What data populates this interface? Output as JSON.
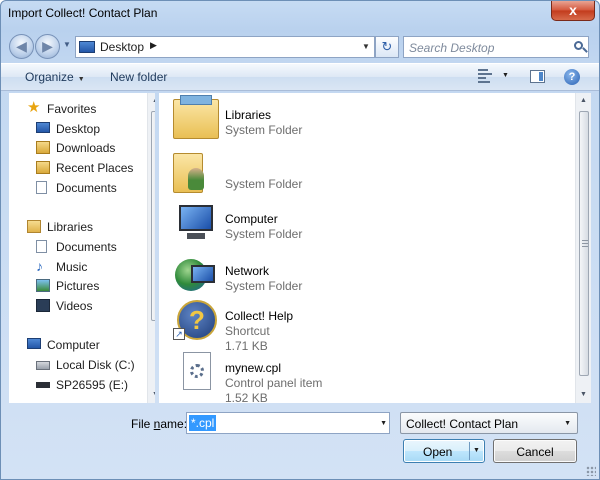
{
  "window": {
    "title": "Import Collect! Contact Plan",
    "close_glyph": "x"
  },
  "navigation": {
    "back_glyph": "◀",
    "forward_glyph": "▶",
    "address": {
      "location": "Desktop",
      "crumb_arrow": "▶"
    },
    "refresh_glyph": "↻",
    "search": {
      "placeholder": "Search Desktop"
    }
  },
  "toolbar": {
    "organize_label": "Organize",
    "new_folder_label": "New folder",
    "help_glyph": "?"
  },
  "nav_pane": {
    "favorites": {
      "label": "Favorites",
      "items": [
        "Desktop",
        "Downloads",
        "Recent Places",
        "Documents"
      ]
    },
    "libraries": {
      "label": "Libraries",
      "items": [
        "Documents",
        "Music",
        "Pictures",
        "Videos"
      ]
    },
    "computer": {
      "label": "Computer",
      "items": [
        "Local Disk (C:)",
        "SP26595 (E:)"
      ]
    }
  },
  "files": [
    {
      "name": "Libraries",
      "details": [
        "System Folder"
      ],
      "icon": "libraries-icon"
    },
    {
      "name": "",
      "details": [
        "System Folder"
      ],
      "icon": "user-folder-icon"
    },
    {
      "name": "Computer",
      "details": [
        "System Folder"
      ],
      "icon": "computer-icon"
    },
    {
      "name": "Network",
      "details": [
        "System Folder"
      ],
      "icon": "network-icon"
    },
    {
      "name": "Collect! Help",
      "details": [
        "Shortcut",
        "1.71 KB"
      ],
      "icon": "help-shortcut-icon"
    },
    {
      "name": "mynew.cpl",
      "details": [
        "Control panel item",
        "1.52 KB"
      ],
      "icon": "control-panel-icon"
    }
  ],
  "bottom": {
    "file_name_label_pre": "File ",
    "file_name_label_u": "n",
    "file_name_label_post": "ame:",
    "file_name_value": "*.cpl",
    "file_type": "Collect! Contact Plan",
    "open_label": "Open",
    "cancel_label": "Cancel"
  },
  "colors": {
    "selection": "#3399ff",
    "window_frame": "#c3d8f1"
  }
}
